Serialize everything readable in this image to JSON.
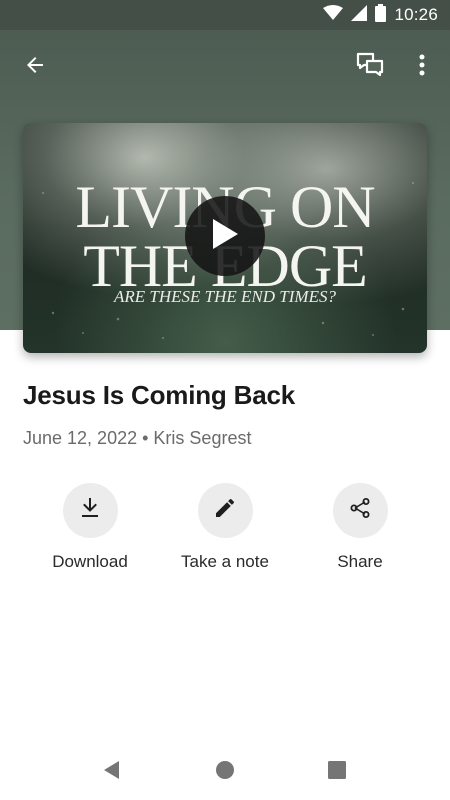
{
  "status_bar": {
    "time": "10:26"
  },
  "app_bar": {
    "back_icon": "arrow-back-icon",
    "chat_icon": "chat-bubbles-icon",
    "menu_icon": "more-vert-icon"
  },
  "media": {
    "thumbnail_title_line1": "LIVING ON",
    "thumbnail_title_line2": "THE EDGE",
    "thumbnail_subtitle": "ARE THESE THE END TIMES?",
    "play_icon": "play-icon"
  },
  "sermon": {
    "title": "Jesus Is Coming Back",
    "date": "June 12, 2022",
    "separator": "•",
    "speaker": "Kris Segrest"
  },
  "actions": [
    {
      "label": "Download",
      "icon": "download-icon"
    },
    {
      "label": "Take a note",
      "icon": "pencil-icon"
    },
    {
      "label": "Share",
      "icon": "share-icon"
    }
  ],
  "colors": {
    "header": "#56665b",
    "status_bar": "#434f47",
    "action_circle": "#ececec",
    "meta_text": "#6b6b6b"
  }
}
